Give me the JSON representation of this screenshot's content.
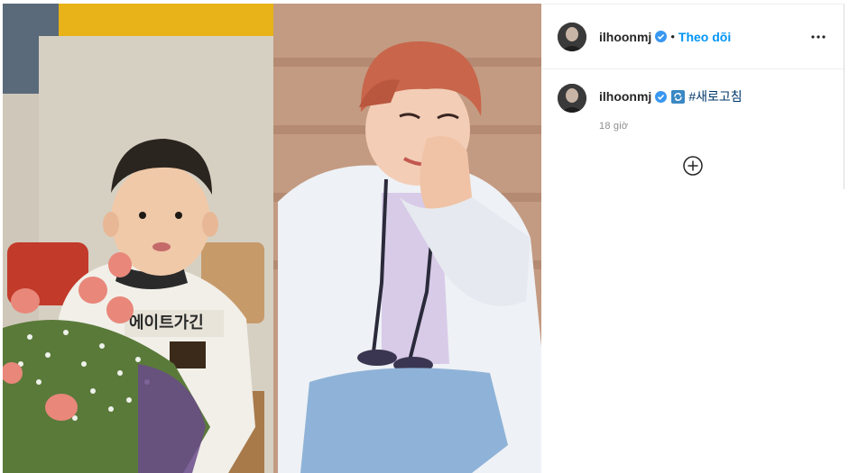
{
  "post": {
    "username": "ilhoonmj",
    "separator": "•",
    "follow_label": "Theo dõi",
    "more_icon": "more-options-icon",
    "verified_color": "#3897f0",
    "follow_color": "#0095f6"
  },
  "caption": {
    "username": "ilhoonmj",
    "emoji": "refresh-emoji",
    "hashtag": "#새로고침",
    "time": "18 giờ"
  },
  "load_more_icon": "plus-circle-icon"
}
